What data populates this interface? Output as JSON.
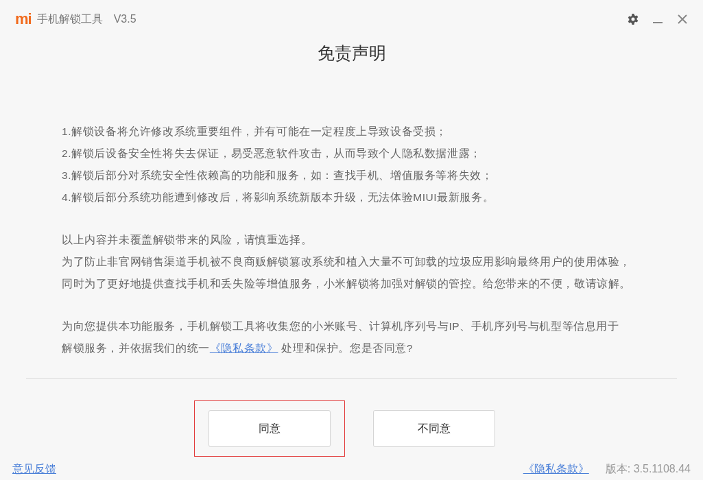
{
  "title_bar": {
    "logo_text": "mi",
    "app_name": "手机解锁工具",
    "version": "V3.5"
  },
  "heading": "免责声明",
  "paragraphs": [
    {
      "lines": [
        {
          "text": "1.解锁设备将允许修改系统重要组件，并有可能在一定程度上导致设备受损；"
        },
        {
          "text": "2.解锁后设备安全性将失去保证，易受恶意软件攻击，从而导致个人隐私数据泄露；"
        },
        {
          "text": "3.解锁后部分对系统安全性依赖高的功能和服务，如：查找手机、增值服务等将失效；"
        },
        {
          "text": "4.解锁后部分系统功能遭到修改后，将影响系统新版本升级，无法体验MIUI最新服务。"
        }
      ]
    },
    {
      "lines": [
        {
          "text": "以上内容并未覆盖解锁带来的风险，请慎重选择。"
        },
        {
          "text": "为了防止非官网销售渠道手机被不良商贩解锁篡改系统和植入大量不可卸载的垃圾应用影响最终用户的使用体验，"
        },
        {
          "text": "同时为了更好地提供查找手机和丢失险等增值服务，小米解锁将加强对解锁的管控。给您带来的不便，敬请谅解。"
        }
      ]
    },
    {
      "lines": [
        {
          "text": "为向您提供本功能服务，手机解锁工具将收集您的小米账号、计算机序列号与IP、手机序列号与机型等信息用于"
        },
        {
          "text": "解锁服务，并依据我们的统一",
          "link": "《隐私条款》",
          "after": " 处理和保护。您是否同意?"
        }
      ]
    }
  ],
  "buttons": [
    {
      "label": "同意",
      "highlighted": true
    },
    {
      "label": "不同意",
      "highlighted": false
    }
  ],
  "footer": {
    "feedback_link": "意见反馈",
    "privacy_link": "《隐私条款》",
    "version": "版本: 3.5.1108.44"
  }
}
